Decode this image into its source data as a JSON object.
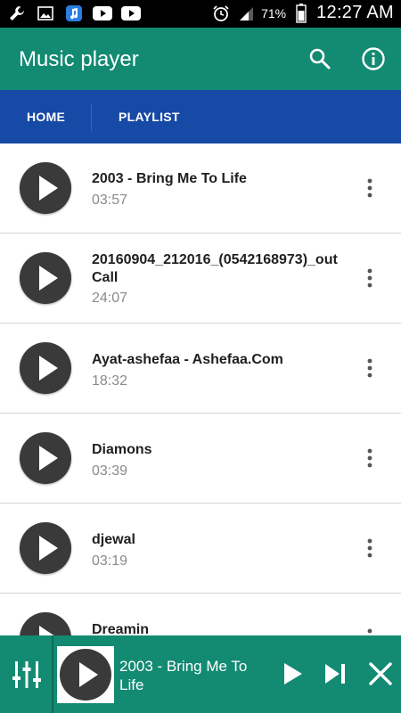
{
  "status_bar": {
    "icons_left": [
      "wrench-icon",
      "image-icon",
      "music-app-icon",
      "youtube-icon",
      "youtube-icon"
    ],
    "icons_right": [
      "alarm-icon",
      "signal-icon"
    ],
    "battery_percent": "71%",
    "time": "12:27 AM"
  },
  "app_bar": {
    "title": "Music player",
    "actions": [
      "search-icon",
      "info-icon"
    ]
  },
  "tabs": [
    {
      "label": "HOME"
    },
    {
      "label": "PLAYLIST"
    }
  ],
  "songs": [
    {
      "title": "2003 - Bring Me To Life",
      "duration": "03:57"
    },
    {
      "title": "20160904_212016_(0542168973)_outCall",
      "duration": "24:07"
    },
    {
      "title": "Ayat-ashefaa - Ashefaa.Com",
      "duration": "18:32"
    },
    {
      "title": "Diamons",
      "duration": "03:39"
    },
    {
      "title": "djewal",
      "duration": "03:19"
    },
    {
      "title": "Dreamin",
      "duration": ""
    }
  ],
  "now_playing": {
    "title": "2003 - Bring Me To Life"
  },
  "colors": {
    "app_bar": "#138a72",
    "tab_bar": "#1749a6",
    "player_bar": "#138a72"
  }
}
